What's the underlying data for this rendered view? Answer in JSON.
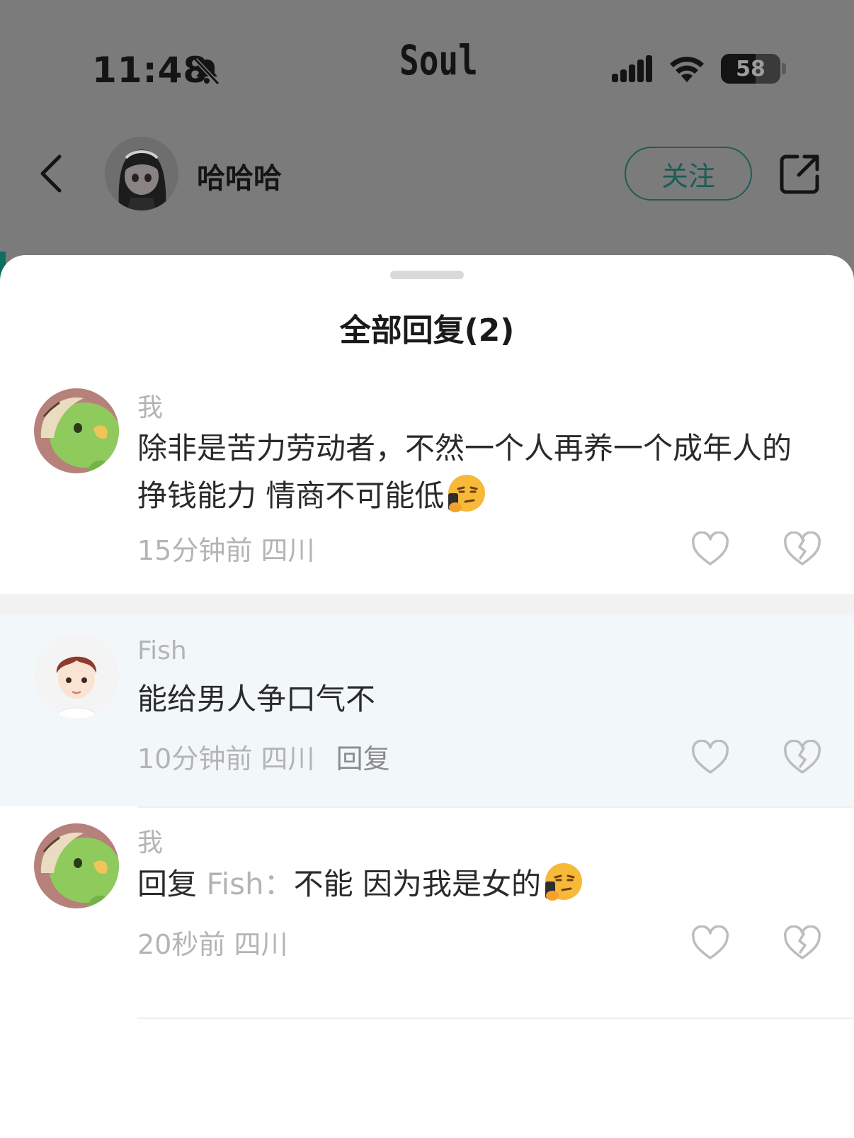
{
  "status_bar": {
    "time": "11:48",
    "app_name": "Soul",
    "battery_level": "58",
    "battery_fraction": 0.58
  },
  "header": {
    "author_name": "哈哈哈",
    "follow_label": "关注"
  },
  "sheet": {
    "title": "全部回复(2)"
  },
  "replies": [
    {
      "name": "我",
      "text": "除非是苦力劳动者，不然一个人再养一个成年人的挣钱能力 情商不可能低",
      "emoji": "smirk-phone-emoji",
      "time": "15分钟前",
      "location": "四川",
      "reply_label": ""
    },
    {
      "name": "Fish",
      "text": "能给男人争口气不",
      "time": "10分钟前",
      "location": "四川",
      "reply_label": "回复"
    },
    {
      "name": "我",
      "reply_prefix": "回复",
      "reply_target": "Fish：",
      "text": "不能 因为我是女的",
      "emoji": "smirk-phone-emoji",
      "time": "20秒前",
      "location": "四川",
      "reply_label": ""
    }
  ],
  "colors": {
    "accent": "#1b5e56",
    "muted_text": "#b4b4b4",
    "highlight_bg": "#f2f8fa"
  }
}
